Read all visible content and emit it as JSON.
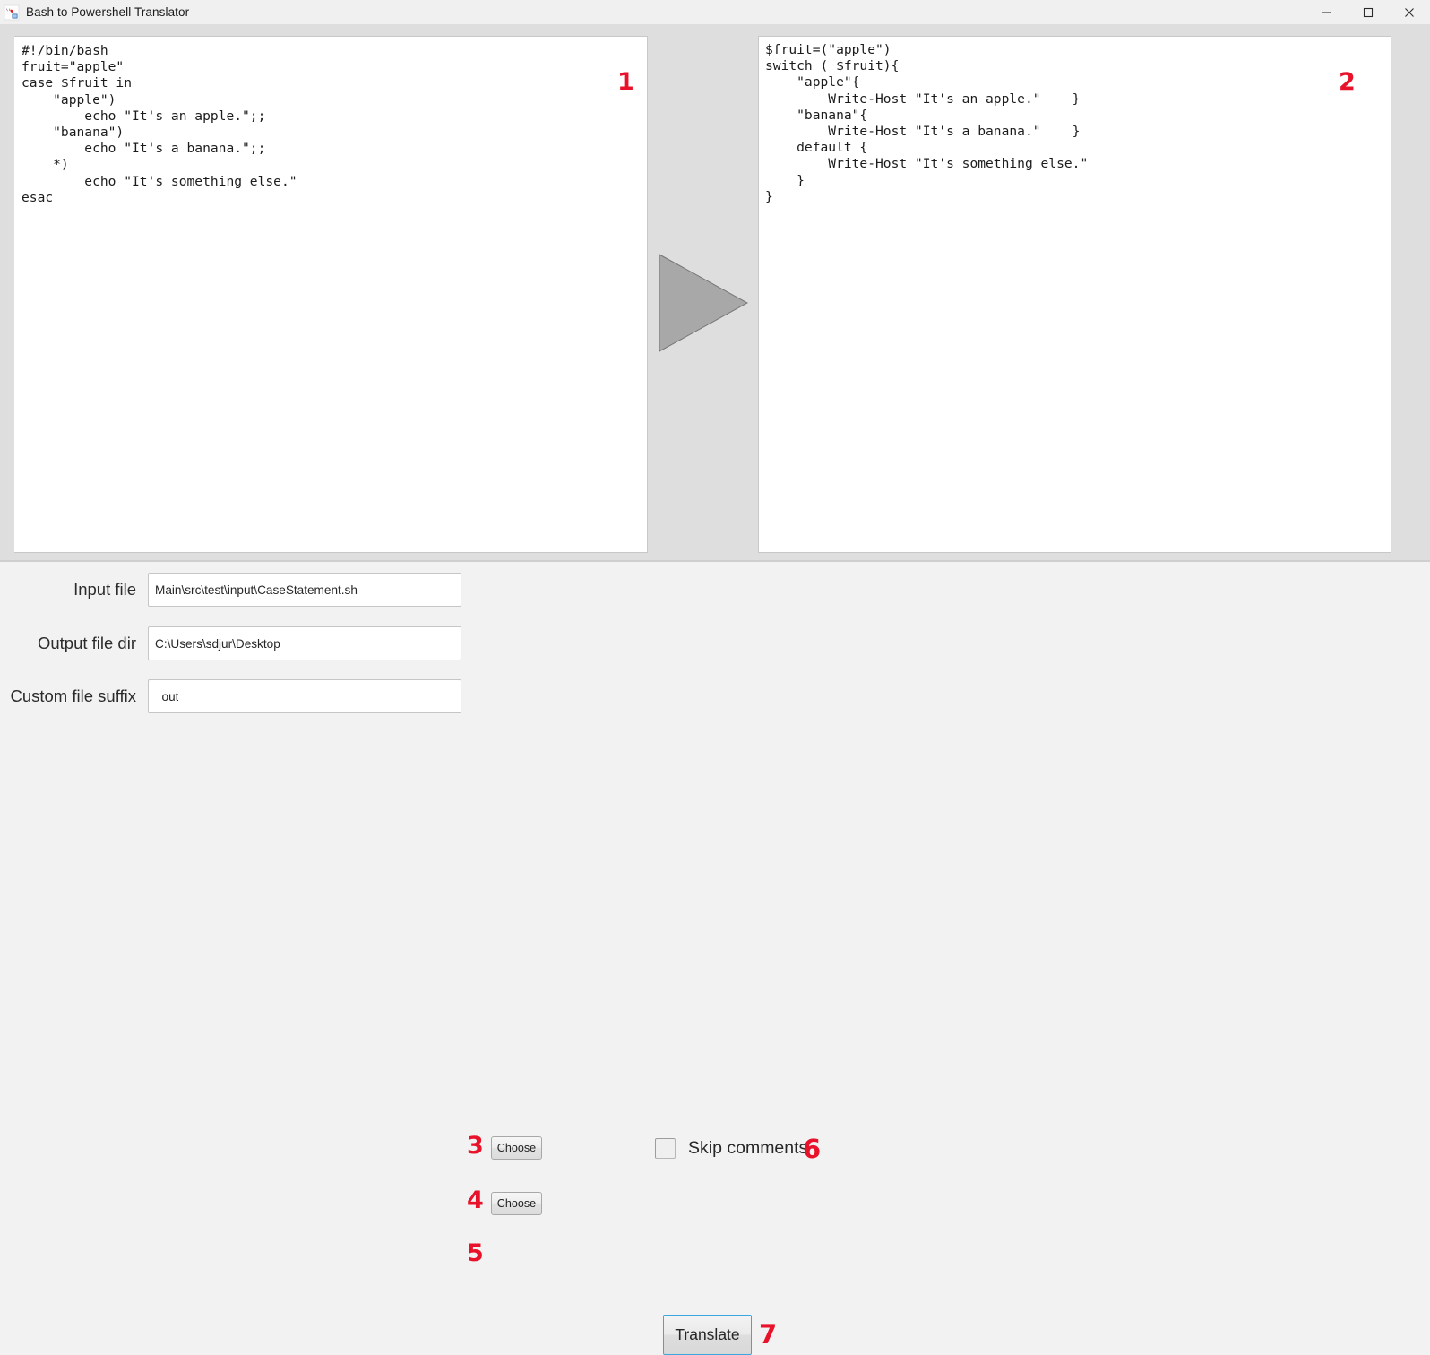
{
  "window": {
    "title": "Bash to Powershell Translator",
    "icon": "app-icon",
    "controls": {
      "minimize": "minimize-icon",
      "maximize": "maximize-icon",
      "close": "close-icon"
    }
  },
  "editors": {
    "source": {
      "annotation": "1",
      "code": "#!/bin/bash\nfruit=\"apple\"\ncase $fruit in\n    \"apple\")\n        echo \"It's an apple.\";;\n    \"banana\")\n        echo \"It's a banana.\";;\n    *)\n        echo \"It's something else.\"\nesac"
    },
    "target": {
      "annotation": "2",
      "code": "$fruit=(\"apple\")\nswitch ( $fruit){\n    \"apple\"{\n        Write-Host \"It's an apple.\"    }\n    \"banana\"{\n        Write-Host \"It's a banana.\"    }\n    default {\n        Write-Host \"It's something else.\"\n    }\n}"
    },
    "arrow_icon": "translate-arrow-icon"
  },
  "form": {
    "input_file": {
      "label": "Input file",
      "value": "Main\\src\\test\\input\\CaseStatement.sh",
      "placeholder": "",
      "annotation": "3",
      "choose_label": "Choose"
    },
    "output_dir": {
      "label": "Output file dir",
      "value": "C:\\Users\\sdjur\\Desktop",
      "placeholder": "",
      "annotation": "4",
      "choose_label": "Choose"
    },
    "custom_suffix": {
      "label": "Custom file suffix",
      "value": "_out",
      "placeholder": "",
      "annotation": "5"
    },
    "skip_comments": {
      "label": "Skip comments",
      "checked": false,
      "annotation": "6"
    },
    "translate": {
      "label": "Translate",
      "annotation": "7"
    }
  },
  "colors": {
    "annotation_red": "#e8132b",
    "editor_background": "#dededf",
    "form_background": "#f2f2f2",
    "focus_border": "#3ba7e0"
  }
}
